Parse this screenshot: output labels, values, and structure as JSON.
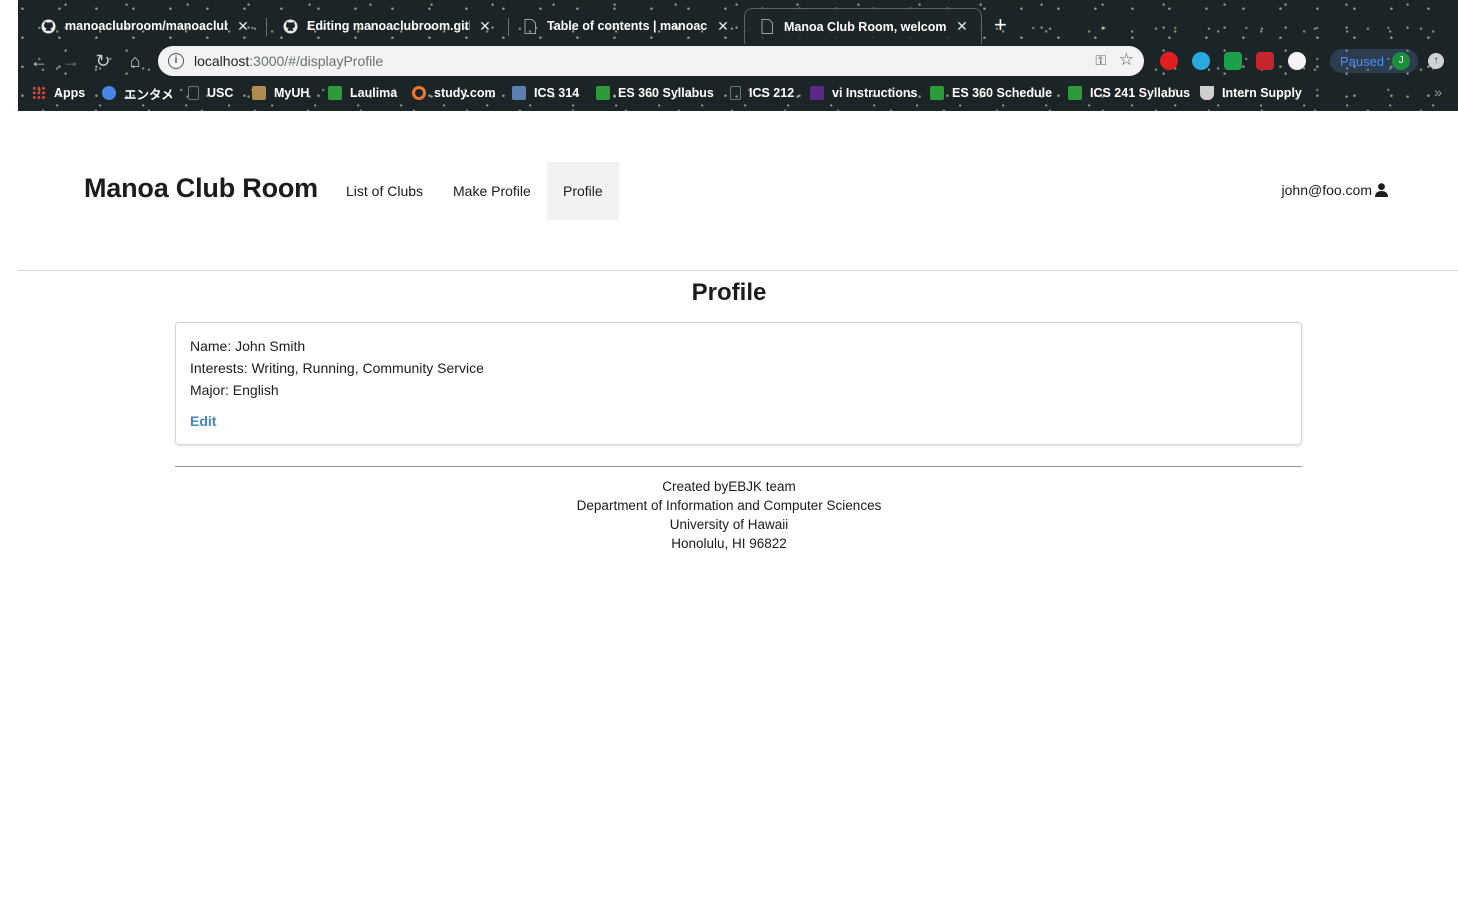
{
  "browser": {
    "tabs": [
      {
        "title": "manoaclubroom/manoaclubroom",
        "icon": "github-icon",
        "active": false
      },
      {
        "title": "Editing manoaclubroom.github",
        "icon": "github-icon",
        "active": false
      },
      {
        "title": "Table of contents | manoaclubroom",
        "icon": "document-icon",
        "active": false
      },
      {
        "title": "Manoa Club Room, welcome!!!",
        "icon": "document-icon",
        "active": true
      }
    ],
    "url_host": "localhost",
    "url_rest": ":3000/#/displayProfile",
    "profile_status": "Paused",
    "profile_initial": "J",
    "bookmarks": [
      {
        "label": "Apps",
        "icon": "apps-grid-icon",
        "color": "#e94235"
      },
      {
        "label": "エンタメ",
        "icon": "folder-icon",
        "color": "#4a86e8"
      },
      {
        "label": "USC",
        "icon": "document-icon",
        "color": "#3a4345"
      },
      {
        "label": "MyUH",
        "icon": "uh-icon",
        "color": "#b08a4e"
      },
      {
        "label": "Laulima",
        "icon": "laulima-icon",
        "color": "#2e9b3b"
      },
      {
        "label": "study.com",
        "icon": "study-icon",
        "color": "#f0772e"
      },
      {
        "label": "ICS 314",
        "icon": "square-icon",
        "color": "#5a7fb0"
      },
      {
        "label": "ES 360 Syllabus",
        "icon": "laulima-icon",
        "color": "#2e9b3b"
      },
      {
        "label": "ICS 212",
        "icon": "document-icon",
        "color": "#3a4345"
      },
      {
        "label": "vi Instructions",
        "icon": "w-icon",
        "color": "#5b2a86"
      },
      {
        "label": "ES 360 Schedule",
        "icon": "laulima-icon",
        "color": "#2e9b3b"
      },
      {
        "label": "ICS 241 Syllabus",
        "icon": "laulima-icon",
        "color": "#2e9b3b"
      },
      {
        "label": "Intern Supply",
        "icon": "cup-icon",
        "color": "#cfcfcf"
      }
    ]
  },
  "navbar": {
    "brand": "Manoa Club Room",
    "items": [
      {
        "label": "List of Clubs"
      },
      {
        "label": "Make Profile"
      },
      {
        "label": "Profile"
      }
    ],
    "active_item": "Profile",
    "user_email": "john@foo.com"
  },
  "main": {
    "title": "Profile",
    "profile": {
      "name_line": "Name: John Smith",
      "interests_line": "Interests: Writing, Running, Community Service",
      "major_line": "Major: English",
      "edit_label": "Edit"
    }
  },
  "footer": {
    "line1": "Created byEBJK team",
    "line2": "Department of Information and Computer Sciences",
    "line3": "University of Hawaii",
    "line4": "Honolulu, HI 96822"
  },
  "colors": {
    "link": "#4183c4",
    "active_menu_bg": "#f2f2f2",
    "chrome_bg": "#1b2426"
  }
}
